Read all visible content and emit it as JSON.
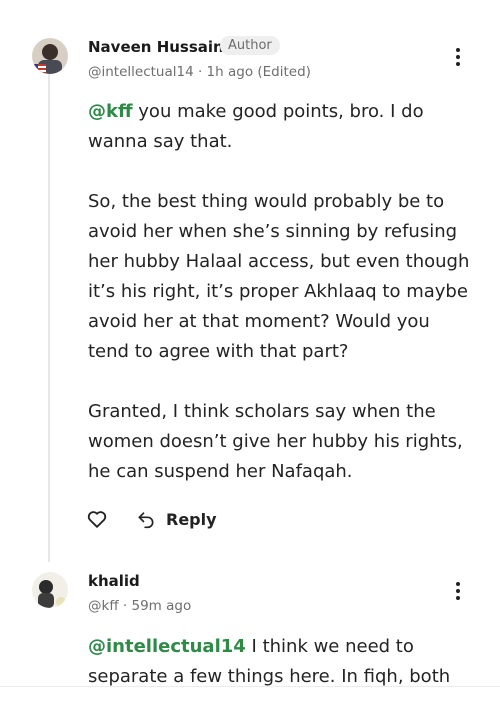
{
  "comments": [
    {
      "author": "Naveen Hussain",
      "badge": "Author",
      "meta": "@intellectual14 · 1h ago (Edited)",
      "mention": "@kff",
      "lines": [
        [
          " you make good points, bro. I do",
          "wanna say that."
        ],
        [
          "So, the best thing would probably be to",
          "avoid her when she’s sinning by refusing",
          "her hubby Halaal access, but even though",
          "it’s his right, it’s proper Akhlaaq to maybe",
          "avoid her at that moment? Would you",
          "tend to agree with that part?"
        ],
        [
          "Granted, I think scholars say when the",
          "women doesn’t give her hubby his rights,",
          "he can suspend her Nafaqah."
        ]
      ],
      "reply_label": "Reply"
    },
    {
      "author": "khalid",
      "meta": "@kff · 59m ago",
      "mention": "@intellectual14",
      "lines": [
        [
          " I think we need to",
          "separate a few things here. In fiqh, both"
        ]
      ]
    }
  ],
  "icons": {
    "more": "more-vertical-icon",
    "like": "heart-icon",
    "reply": "reply-arrow-icon"
  },
  "colors": {
    "mention": "#2e8a47",
    "badge_bg": "#efefef",
    "meta": "#6e6e6e"
  }
}
